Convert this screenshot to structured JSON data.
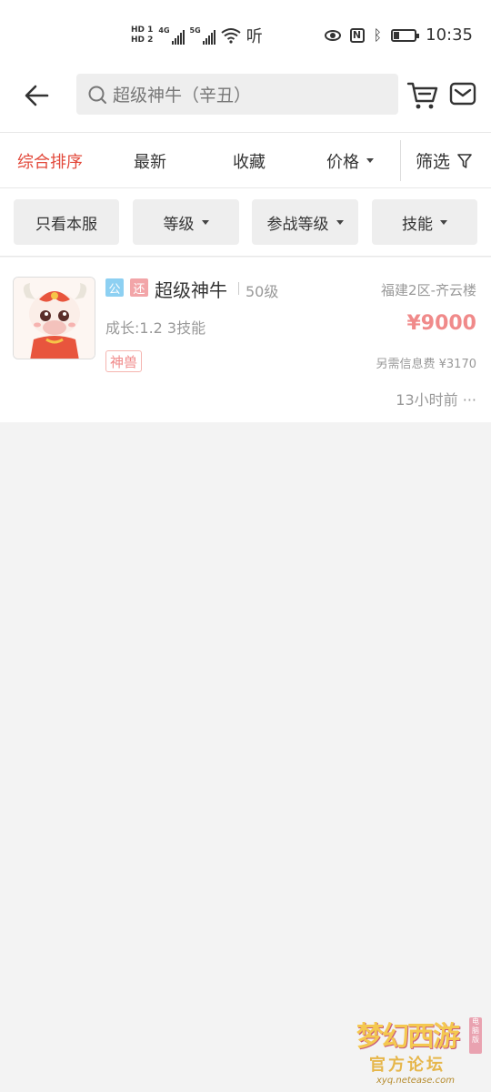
{
  "status_bar": {
    "hd_labels": [
      "HD 1",
      "HD 2"
    ],
    "net1": "4G",
    "net2": "5G",
    "ting": "听",
    "time": "10:35"
  },
  "search": {
    "query": "超级神牛（辛丑）"
  },
  "sort_tabs": [
    {
      "label": "综合排序",
      "active": true
    },
    {
      "label": "最新"
    },
    {
      "label": "收藏"
    },
    {
      "label": "价格"
    }
  ],
  "filter_label": "筛选",
  "chips": [
    "只看本服",
    "等级",
    "参战等级",
    "技能"
  ],
  "listing": {
    "tag_gong": "公",
    "tag_huan": "还",
    "name": "超级神牛",
    "level": "50级",
    "server": "福建2区-齐云楼",
    "growth": "成长:1.2 3技能",
    "price": "¥9000",
    "badge": "神兽",
    "fee": "另需信息费 ¥3170",
    "time": "13小时前 ···"
  },
  "watermark": {
    "title": "梦幻西游",
    "subtitle": "官方论坛",
    "url": "xyq.netease.com",
    "stamp": "电脑版"
  },
  "colors": {
    "accent": "#e2483a",
    "price": "#f08a8a",
    "tag_gong": "#8dd0f2",
    "tag_huan": "#f2a5a8"
  }
}
